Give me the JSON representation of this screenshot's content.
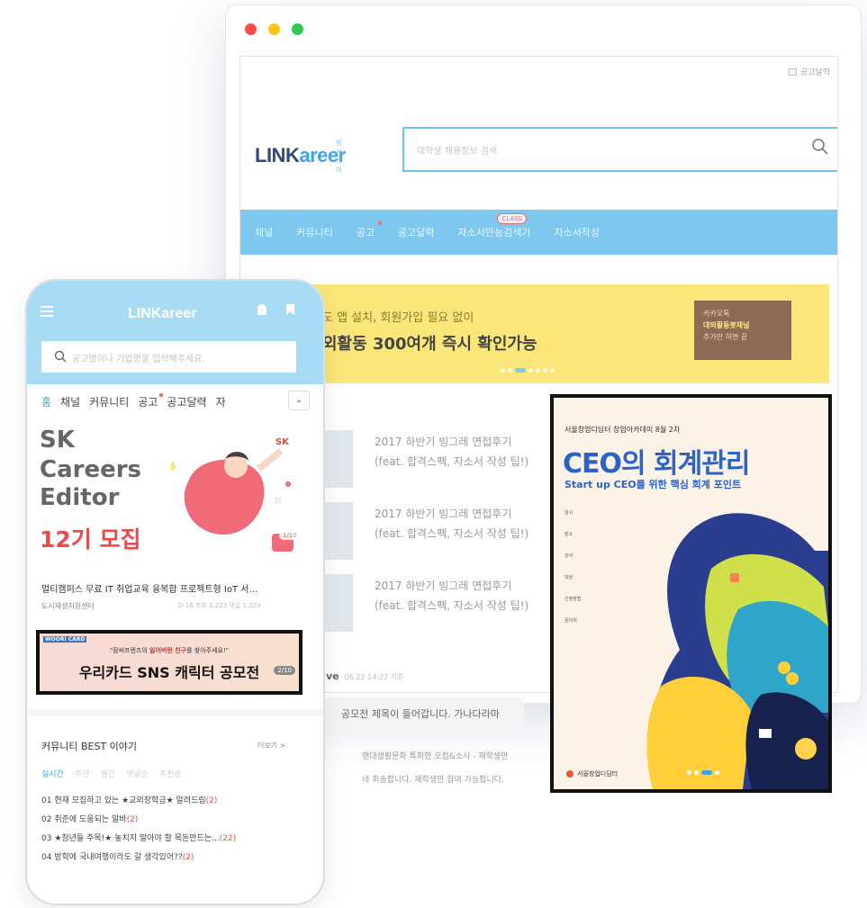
{
  "colors": {
    "accent": "#7ec8f0",
    "brand_dark": "#2f4a7a",
    "red": "#e94b4b",
    "yellow_banner": "#fbe679"
  },
  "window_dots": [
    "#ff4b4b",
    "#ffc21a",
    "#2fc94f"
  ],
  "desktop": {
    "top_link": "공고달력",
    "logo_mini": "링커리어",
    "logo_text_a": "LINK",
    "logo_text_b": "areer",
    "search_placeholder": "대학생 채용정보 검색",
    "nav": [
      {
        "label": "채널"
      },
      {
        "label": "커뮤니티"
      },
      {
        "label": "공고",
        "dot": true
      },
      {
        "label": "공고달력"
      },
      {
        "label": "자소서만능검색기",
        "tag": "CLASS"
      },
      {
        "label": "자소서작성"
      }
    ],
    "banner": {
      "line1": "도 앱 설치, 회원가입 필요 없이",
      "line2": "외활동 300여개 즉시 확인가능",
      "kakao_line1": "카카오톡",
      "kakao_line2": "대외활동봇채널",
      "kakao_line3": "추가만 하면 끝"
    },
    "posts": [
      {
        "title": "2017 하반기 빙그레 면접후기 (feat. 합격스펙, 자소서 작성 팁!)"
      },
      {
        "title": "2017 하반기 빙그레 면접후기 (feat. 합격스펙, 자소서 작성 팁!)"
      },
      {
        "title": "2017 하반기 빙그레 면접후기 (feat. 합격스펙, 자소서 작성 팁!)"
      }
    ],
    "live_label": "ve",
    "live_time": "06.22 14:22 기준",
    "notice": "공모전 제목이 들어갑니다. 가나다라마",
    "desc_line1": "랜대생활문화 특화한 오접&소사 - 재학생만",
    "desc_line2": "네 회송합니다. 재학생만 참여 가능합니다.",
    "poster": {
      "org": "서울창업디딤터 창업아카데미 8월 2차",
      "title": "CEO의 회계관리",
      "subtitle": "Start up CEO를 위한 핵심 회계 포인트",
      "info": [
        "일시",
        "장소",
        "강사",
        "대상",
        "신청방법",
        "문의처"
      ],
      "footer": "서울창업디딤터"
    }
  },
  "mobile": {
    "logo": "LINKareer",
    "search_placeholder": "공고명이나 기업명을 입력해주세요.",
    "tabs": [
      {
        "label": "홈",
        "active": true
      },
      {
        "label": "채널"
      },
      {
        "label": "커뮤니티"
      },
      {
        "label": "공고",
        "dot": true
      },
      {
        "label": "공고달력"
      },
      {
        "label": "자"
      }
    ],
    "hero_lines": [
      "SK",
      "Careers",
      "Editor"
    ],
    "hero_red": "12기 모집",
    "hero_brand": "SK",
    "hero_counter": "1/10",
    "ad_title": "멀티캠퍼스 무료 IT 취업교육 융복합 프로젝트형 IoT 서...",
    "ad_org": "도시재생지원센터",
    "ad_stats": "D-16 조회 1,223 댓글 1,223",
    "woori_brand": "WOORI CARD",
    "woori_sub_a": "\"잠써프렌즈의 ",
    "woori_sub_b": "잃어버린 친구",
    "woori_sub_c": "를 찾아주세요!\"",
    "woori_main": "우리카드 SNS 캐릭터 공모전",
    "woori_count": "2/10",
    "community_title": "커뮤니티 BEST 이야기",
    "community_more": "더보기 >",
    "community_tabs": [
      "실시간",
      "주간",
      "월간",
      "댓글순",
      "추천순"
    ],
    "community_items": [
      {
        "text": "01  현재 모집하고 있는 ★교외장학금★ 알려드림",
        "count": "(2)"
      },
      {
        "text": "02  취준에 도움되는 알바",
        "count": "(2)"
      },
      {
        "text": "03  ★청년들 주목!★ 놓치지 말아야 할 목돈만드는...",
        "count": "(22)"
      },
      {
        "text": "04  방학에 국내여행이라도 갈 생각있어??",
        "count": "(2)"
      }
    ]
  }
}
